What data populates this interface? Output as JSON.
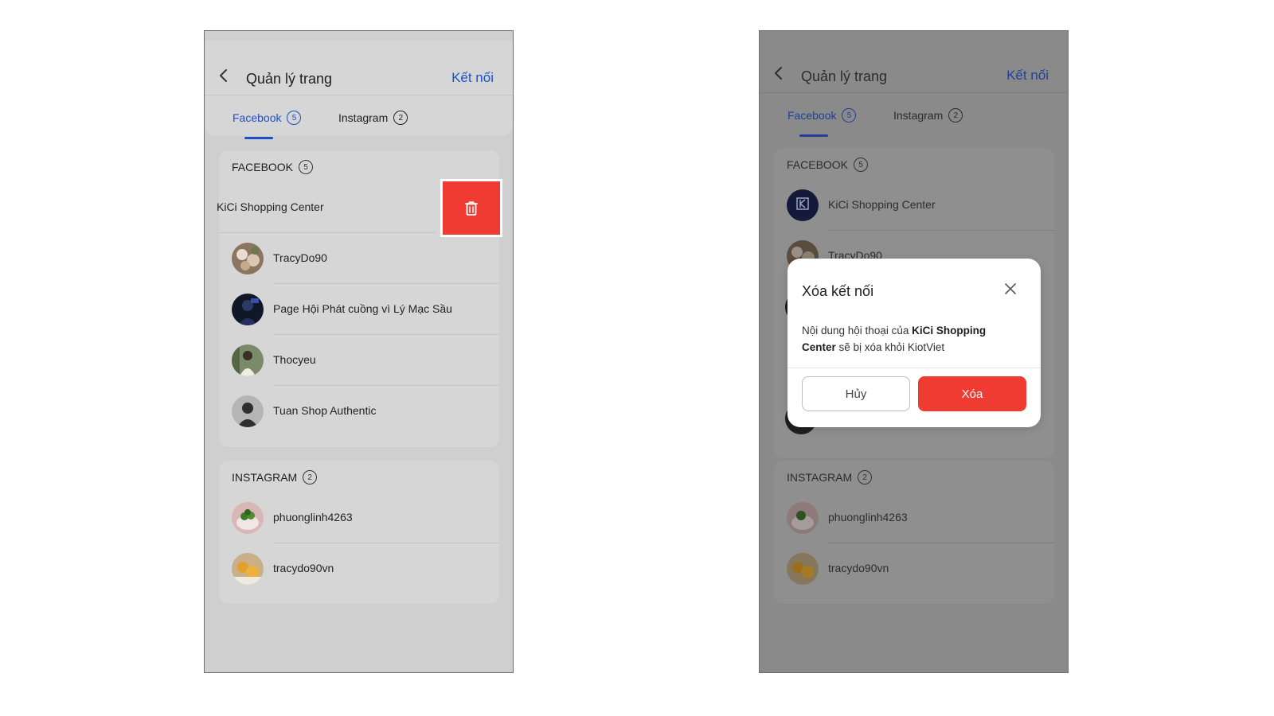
{
  "screen": {
    "title": "Quản lý trang",
    "connect_label": "Kết nối",
    "tabs": [
      {
        "label": "Facebook",
        "count": "5"
      },
      {
        "label": "Instagram",
        "count": "2"
      }
    ]
  },
  "facebook_section": {
    "title": "FACEBOOK",
    "count": "5",
    "pages": [
      {
        "name": "KiCi Shopping Center",
        "swiped_name": "KiCi Shopping Center",
        "avatar_icon": "kici-logo-icon"
      },
      {
        "name": "TracyDo90",
        "avatar_icon": "flowers-photo-avatar"
      },
      {
        "name": "Page Hội Phát cuồng vì Lý Mạc Sầu",
        "avatar_icon": "person-photo-avatar"
      },
      {
        "name": "Thocyeu",
        "avatar_icon": "person-photo-avatar"
      },
      {
        "name": "Tuan Shop Authentic",
        "avatar_icon": "default-user-icon"
      }
    ]
  },
  "instagram_section": {
    "title": "INSTAGRAM",
    "count": "2",
    "accounts": [
      {
        "name": "phuonglinh4263",
        "avatar_icon": "food-photo-avatar"
      },
      {
        "name": "tracydo90vn",
        "avatar_icon": "food-photo-avatar"
      }
    ]
  },
  "delete_action": {
    "icon": "trash-icon",
    "color": "#f03b32"
  },
  "dialog": {
    "title": "Xóa kết nối",
    "message_prefix": "Nội dung hội thoại của ",
    "message_bold": "KiCi Shopping Center",
    "message_suffix": " sẽ bị xóa khỏi KiotViet",
    "cancel_label": "Hủy",
    "confirm_label": "Xóa"
  },
  "colors": {
    "accent": "#1f4fc6",
    "danger": "#f03b32"
  }
}
